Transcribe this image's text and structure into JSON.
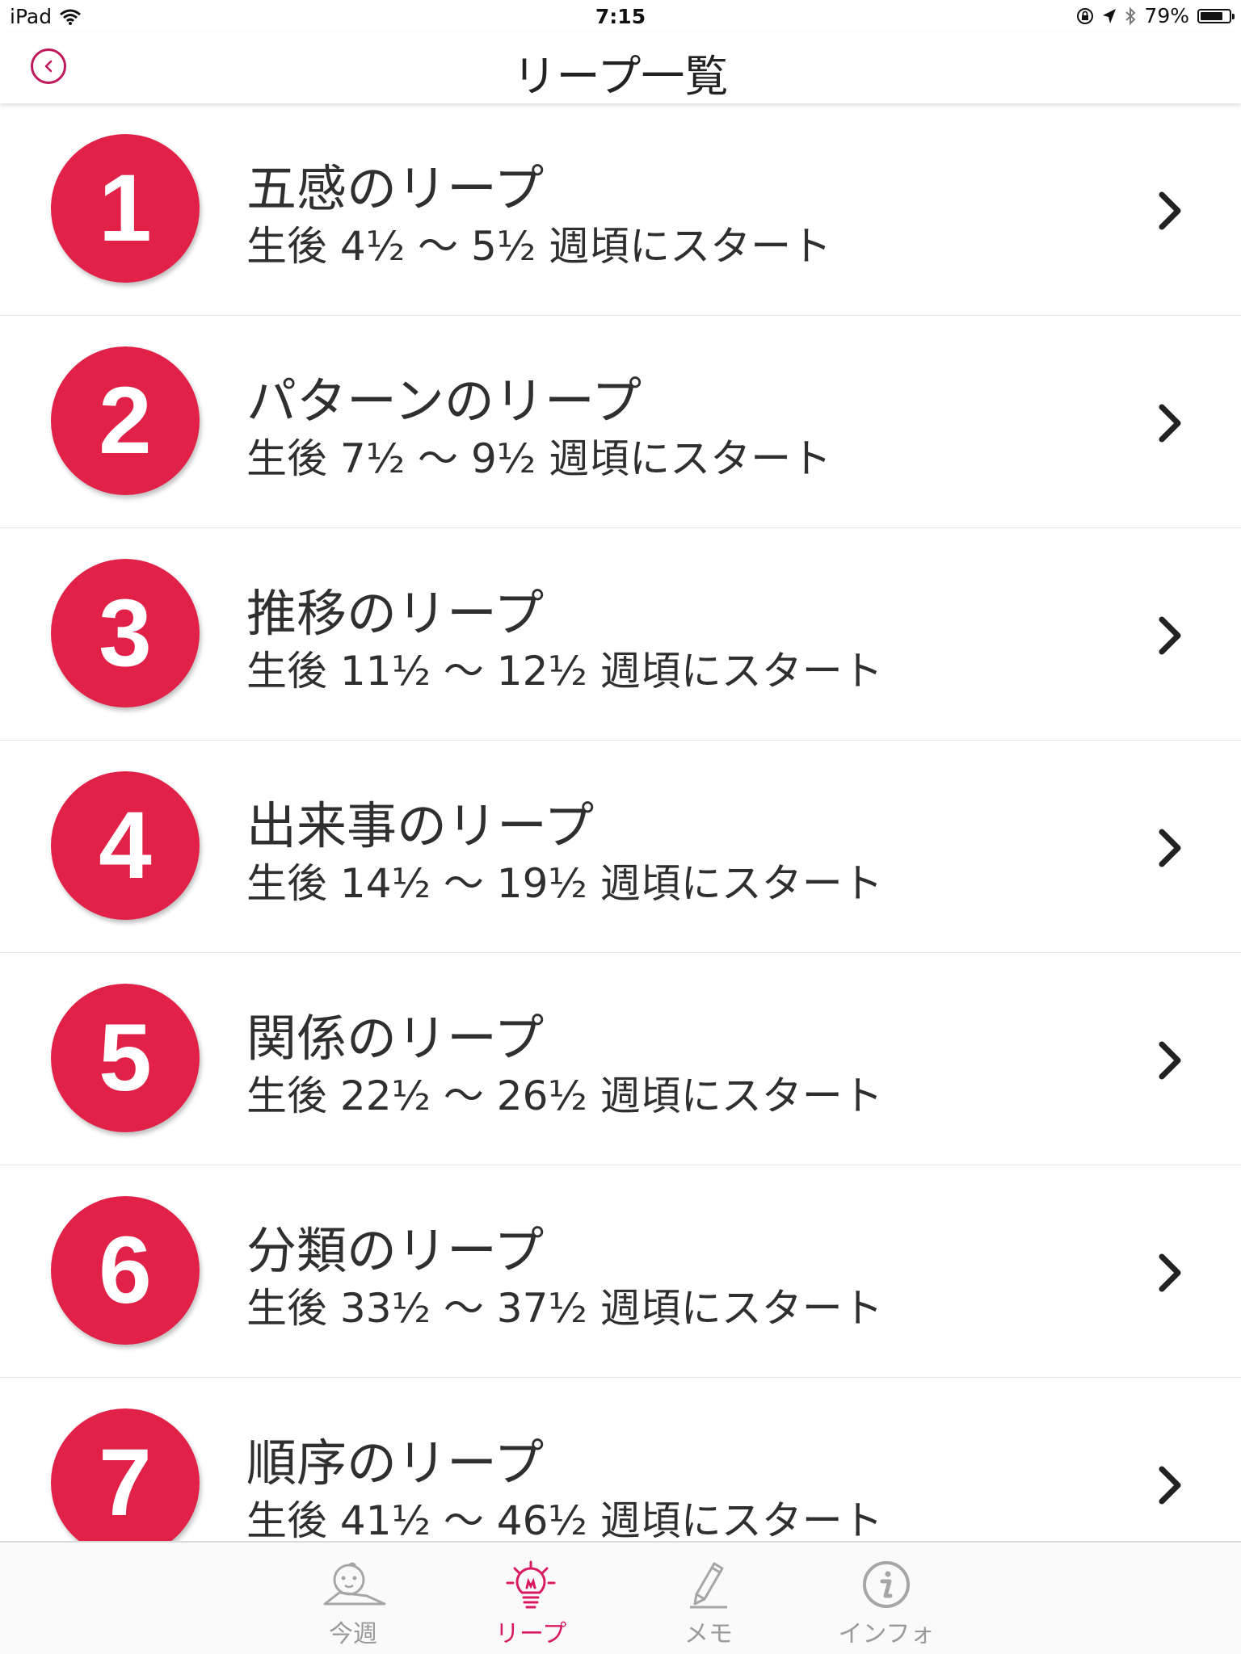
{
  "status_bar": {
    "device": "iPad",
    "time": "7:15",
    "battery_text": "79%",
    "battery_level": 0.79
  },
  "nav": {
    "title": "リープ一覧"
  },
  "colors": {
    "accent": "#e22148",
    "tab_active": "#d81b60",
    "back_button": "#c0175d"
  },
  "leaps": [
    {
      "number": "1",
      "title": "五感のリープ",
      "subtitle": "生後 4½ 〜 5½ 週頃にスタート"
    },
    {
      "number": "2",
      "title": "パターンのリープ",
      "subtitle": "生後 7½ 〜 9½ 週頃にスタート"
    },
    {
      "number": "3",
      "title": "推移のリープ",
      "subtitle": "生後 11½ 〜 12½ 週頃にスタート"
    },
    {
      "number": "4",
      "title": "出来事のリープ",
      "subtitle": "生後 14½ 〜 19½ 週頃にスタート"
    },
    {
      "number": "5",
      "title": "関係のリープ",
      "subtitle": "生後 22½ 〜 26½ 週頃にスタート"
    },
    {
      "number": "6",
      "title": "分類のリープ",
      "subtitle": "生後 33½ 〜 37½ 週頃にスタート"
    },
    {
      "number": "7",
      "title": "順序のリープ",
      "subtitle": "生後 41½ 〜 46½ 週頃にスタート"
    }
  ],
  "tabs": [
    {
      "label": "今週",
      "icon": "baby-icon",
      "active": false
    },
    {
      "label": "リープ",
      "icon": "lightbulb-icon",
      "active": true
    },
    {
      "label": "メモ",
      "icon": "pencil-icon",
      "active": false
    },
    {
      "label": "インフォ",
      "icon": "info-icon",
      "active": false
    }
  ]
}
